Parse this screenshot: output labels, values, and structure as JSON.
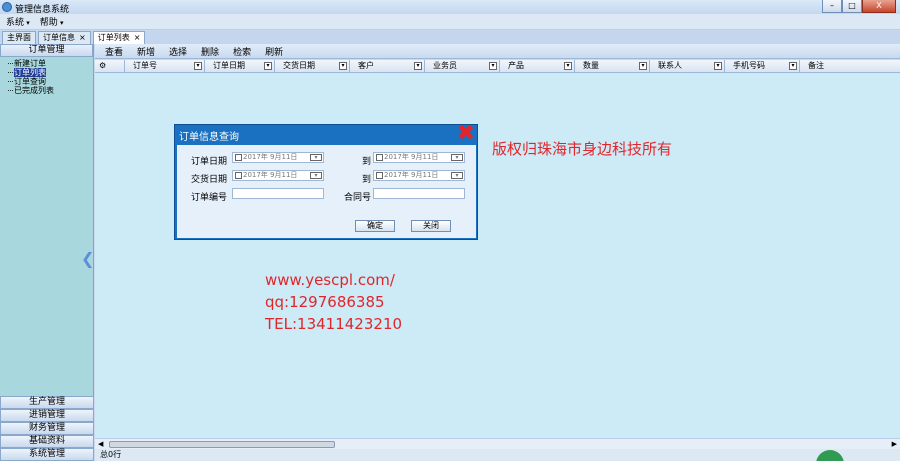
{
  "window": {
    "title": "管理信息系统"
  },
  "win_buttons": {
    "minimize": "–",
    "maximize": "□",
    "close": "X"
  },
  "menu": [
    "系统",
    "帮助"
  ],
  "tabs": [
    {
      "label": "主界面",
      "active": false,
      "closable": false
    },
    {
      "label": "订单信息",
      "active": false,
      "closable": true
    },
    {
      "label": "订单列表",
      "active": true,
      "closable": true
    }
  ],
  "sidebar": {
    "header": "订单管理",
    "tree": [
      {
        "label": "新建订单",
        "selected": false
      },
      {
        "label": "订单列表",
        "selected": true
      },
      {
        "label": "订单查询",
        "selected": false
      },
      {
        "label": "已完成列表",
        "selected": false
      }
    ],
    "bottom_buttons": [
      "生产管理",
      "进销管理",
      "财务管理",
      "基础资料",
      "系统管理"
    ]
  },
  "toolbar": [
    "查看",
    "新增",
    "选择",
    "删除",
    "检索",
    "刷新"
  ],
  "grid_columns": [
    "订单号",
    "订单日期",
    "交货日期",
    "客户",
    "业务员",
    "产品",
    "数量",
    "联系人",
    "手机号码",
    "备注"
  ],
  "dialog": {
    "title": "订单信息查询",
    "close_icon": "✖",
    "to_label_1": "到",
    "to_label_2": "到",
    "order_date_label": "订单日期",
    "order_date_from": "2017年 9月11日",
    "order_date_to": "2017年 9月11日",
    "delivery_date_label": "交货日期",
    "delivery_date_from": "2017年 9月11日",
    "delivery_date_to": "2017年 9月11日",
    "order_no_label": "订单编号",
    "contract_no_label": "合同号",
    "ok_button": "确定",
    "close_button": "关闭"
  },
  "overlay": {
    "copyright": "版权归珠海市身边科技所有",
    "website": "www.yescpl.com/",
    "qq": "qq:1297686385",
    "tel": "TEL:13411423210"
  },
  "status": {
    "total": "总0行"
  },
  "colors": {
    "accent": "#1a71c2",
    "overlay_text": "#e0262b"
  }
}
